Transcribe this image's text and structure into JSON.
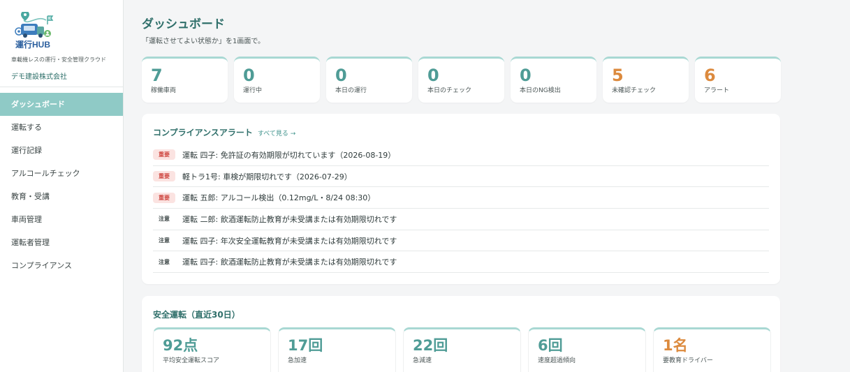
{
  "brand": {
    "logo_text": "運行HUB",
    "tagline": "車載機レスの運行・安全管理クラウド",
    "company": "デモ建設株式会社",
    "accent_color": "#8fcac6",
    "title_color": "#2f6f6a",
    "warning_color": "#dc8a3e",
    "critical_color": "#cf4a43"
  },
  "nav": {
    "items": [
      {
        "label": "ダッシュボード",
        "active": true
      },
      {
        "label": "運転する"
      },
      {
        "label": "運行記録"
      },
      {
        "label": "アルコールチェック"
      },
      {
        "label": "教育・受講"
      },
      {
        "label": "車両管理"
      },
      {
        "label": "運転者管理"
      },
      {
        "label": "コンプライアンス"
      }
    ]
  },
  "header": {
    "title": "ダッシュボード",
    "subtitle": "「運転させてよい状態か」を1画面で。"
  },
  "stats": [
    {
      "value": "7",
      "label": "稼働車両",
      "tone": "teal"
    },
    {
      "value": "0",
      "label": "運行中",
      "tone": "teal"
    },
    {
      "value": "0",
      "label": "本日の運行",
      "tone": "teal"
    },
    {
      "value": "0",
      "label": "本日のチェック",
      "tone": "teal"
    },
    {
      "value": "0",
      "label": "本日のNG検出",
      "tone": "teal"
    },
    {
      "value": "5",
      "label": "未確認チェック",
      "tone": "orange"
    },
    {
      "value": "6",
      "label": "アラート",
      "tone": "orange"
    }
  ],
  "alerts": {
    "title": "コンプライアンスアラート",
    "see_all": "すべて見る →",
    "items": [
      {
        "level": "重要",
        "severity": "critical",
        "text": "運転 四子: 免許証の有効期限が切れています（2026-08-19）"
      },
      {
        "level": "重要",
        "severity": "critical",
        "text": "軽トラ1号: 車検が期限切れです（2026-07-29）"
      },
      {
        "level": "重要",
        "severity": "critical",
        "text": "運転 五郎: アルコール検出（0.12mg/L・8/24 08:30）"
      },
      {
        "level": "注意",
        "severity": "warning",
        "text": "運転 二郎: 飲酒運転防止教育が未受講または有効期限切れです"
      },
      {
        "level": "注意",
        "severity": "warning",
        "text": "運転 四子: 年次安全運転教育が未受講または有効期限切れです"
      },
      {
        "level": "注意",
        "severity": "warning",
        "text": "運転 四子: 飲酒運転防止教育が未受講または有効期限切れです"
      }
    ]
  },
  "safety": {
    "title": "安全運転（直近30日）",
    "cards": [
      {
        "value": "92点",
        "label": "平均安全運転スコア",
        "tone": "teal"
      },
      {
        "value": "17回",
        "label": "急加速",
        "tone": "teal"
      },
      {
        "value": "22回",
        "label": "急減速",
        "tone": "teal"
      },
      {
        "value": "6回",
        "label": "速度超過傾向",
        "tone": "teal"
      },
      {
        "value": "1名",
        "label": "要教育ドライバー",
        "tone": "orange"
      }
    ]
  }
}
